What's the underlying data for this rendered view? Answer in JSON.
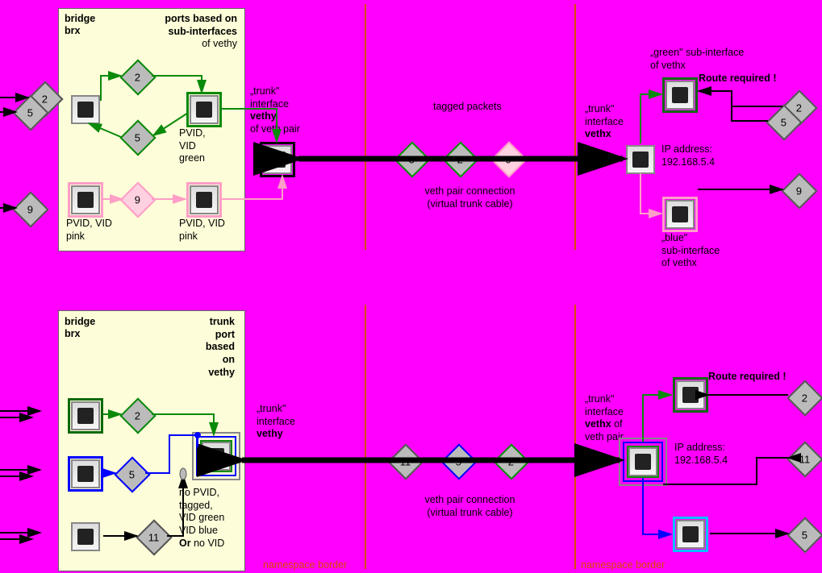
{
  "top": {
    "panel": {
      "title1": "bridge",
      "title2": "brx",
      "rightTitle1": "ports based on",
      "rightTitle2": "sub-interfaces",
      "rightTitle3": "of vethy"
    },
    "leftDiamonds": {
      "d2": "2",
      "d5": "5",
      "d9": "9"
    },
    "insideDiamonds": {
      "d2": "2",
      "d5": "5",
      "d9": "9"
    },
    "pvidGreen": "PVID,\nVID\ngreen",
    "pvidPink1": "PVID, VID\npink",
    "pvidPink2": "PVID, VID\npink",
    "trunkVethy": {
      "l1": "„trunk\"",
      "l2": "interface",
      "l3": "vethy",
      "l4": "of veth pair"
    },
    "midDiamonds": {
      "d5": "5",
      "d2": "2",
      "d9": "9"
    },
    "taggedPackets": "tagged packets",
    "vethPair1": "veth pair connection",
    "vethPair2": "(virtual trunk cable)",
    "trunkVethx": {
      "l1": "„trunk\"",
      "l2": "interface",
      "l3": "vethx"
    },
    "ipAddr": {
      "l1": "IP address:",
      "l2": "192.168.5.4"
    },
    "greenSub": {
      "l1": "„green\" sub-interface",
      "l2": "of vethx"
    },
    "blueSub": {
      "l1": "„blue\"",
      "l2": "sub-interface",
      "l3": "of vethx"
    },
    "routeReq": "Route required !",
    "rightDiamonds": {
      "d2": "2",
      "d5": "5",
      "d9": "9"
    }
  },
  "bottom": {
    "panel": {
      "title1": "bridge",
      "title2": "brx",
      "rightTitle1": "trunk",
      "rightTitle2": "port",
      "rightTitle3": "based",
      "rightTitle4": "on",
      "rightTitle5": "vethy"
    },
    "leftDiamonds": {
      "d2": "2",
      "d5": "5",
      "d11": "11"
    },
    "trunkVethy": {
      "l1": "„trunk\"",
      "l2": "interface",
      "l3": "vethy"
    },
    "noPvid": {
      "l1": "no PVID,",
      "l2": "tagged,",
      "l3": "VID green",
      "l4": "VID blue",
      "l5a": "Or",
      "l5b": " no VID"
    },
    "midDiamonds": {
      "d11": "11",
      "d5": "5",
      "d2": "2"
    },
    "vethPair1": "veth pair connection",
    "vethPair2": "(virtual trunk cable)",
    "trunkVethx": {
      "l1": "„trunk\"",
      "l2": "interface",
      "l3": "vethx",
      "l4": "veth pair"
    },
    "trunkVethxOf": "of",
    "ipAddr": {
      "l1": "IP address:",
      "l2": "192.168.5.4"
    },
    "routeReq": "Route required !",
    "rightDiamonds": {
      "d2": "2",
      "d11": "11",
      "d5": "5"
    },
    "nsBorder": "namespace border"
  }
}
